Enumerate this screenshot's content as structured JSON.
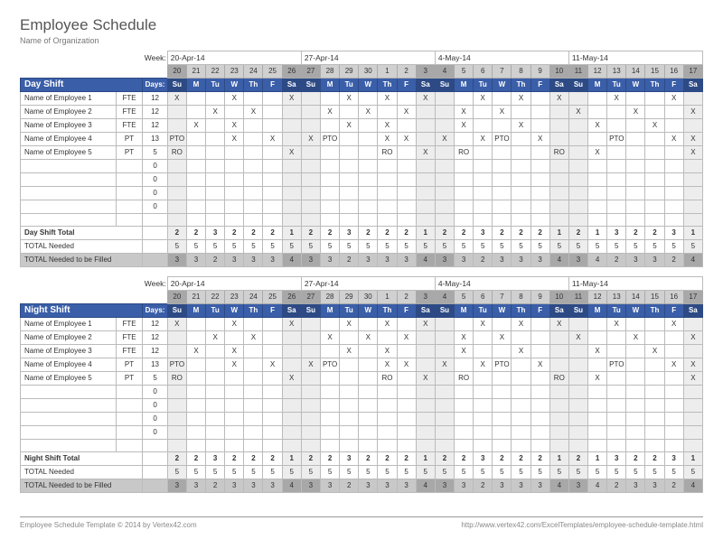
{
  "title": "Employee Schedule",
  "org": "Name of Organization",
  "week_label": "Week:",
  "weeks": [
    "20-Apr-14",
    "27-Apr-14",
    "4-May-14",
    "11-May-14"
  ],
  "day_nums": [
    20,
    21,
    22,
    23,
    24,
    25,
    26,
    27,
    28,
    29,
    30,
    1,
    2,
    3,
    4,
    5,
    6,
    7,
    8,
    9,
    10,
    11,
    12,
    13,
    14,
    15,
    16,
    17
  ],
  "day_abbr": [
    "Su",
    "M",
    "Tu",
    "W",
    "Th",
    "F",
    "Sa",
    "Su",
    "M",
    "Tu",
    "W",
    "Th",
    "F",
    "Sa",
    "Su",
    "M",
    "Tu",
    "W",
    "Th",
    "F",
    "Sa",
    "Su",
    "M",
    "Tu",
    "W",
    "Th",
    "F",
    "Sa"
  ],
  "weekend": [
    true,
    false,
    false,
    false,
    false,
    false,
    true,
    true,
    false,
    false,
    false,
    false,
    false,
    true,
    true,
    false,
    false,
    false,
    false,
    false,
    true,
    true,
    false,
    false,
    false,
    false,
    false,
    true
  ],
  "days_head": "Days:",
  "shifts": [
    {
      "name": "Day Shift",
      "employees": [
        {
          "name": "Name of Employee 1",
          "type": "FTE",
          "days": 12,
          "marks": [
            "X",
            "",
            "",
            "X",
            "",
            "",
            "X",
            "",
            "",
            "X",
            "",
            "X",
            "",
            "X",
            "",
            "",
            "X",
            "",
            "X",
            "",
            "X",
            "",
            "",
            "X",
            "",
            "",
            "X",
            ""
          ]
        },
        {
          "name": "Name of Employee 2",
          "type": "FTE",
          "days": 12,
          "marks": [
            "",
            "",
            "X",
            "",
            "X",
            "",
            "",
            "",
            "X",
            "",
            "X",
            "",
            "X",
            "",
            "",
            "X",
            "",
            "X",
            "",
            "",
            "",
            "X",
            "",
            "",
            "X",
            "",
            "",
            "X"
          ]
        },
        {
          "name": "Name of Employee 3",
          "type": "FTE",
          "days": 12,
          "marks": [
            "",
            "X",
            "",
            "X",
            "",
            "",
            "",
            "",
            "",
            "X",
            "",
            "X",
            "",
            "",
            "",
            "X",
            "",
            "",
            "X",
            "",
            "",
            "",
            "X",
            "",
            "",
            "X",
            "",
            ""
          ]
        },
        {
          "name": "Name of Employee 4",
          "type": "PT",
          "days": 13,
          "marks": [
            "PTO",
            "",
            "",
            "X",
            "",
            "X",
            "",
            "X",
            "PTO",
            "",
            "",
            "X",
            "X",
            "",
            "X",
            "",
            "X",
            "PTO",
            "",
            "X",
            "",
            "",
            "",
            "PTO",
            "",
            "",
            "X",
            "X"
          ]
        },
        {
          "name": "Name of Employee 5",
          "type": "PT",
          "days": 5,
          "marks": [
            "RO",
            "",
            "",
            "",
            "",
            "",
            "X",
            "",
            "",
            "",
            "",
            "RO",
            "",
            "X",
            "",
            "RO",
            "",
            "",
            "",
            "",
            "RO",
            "",
            "X",
            "",
            "",
            "",
            "",
            "X"
          ]
        }
      ],
      "blank_rows": 4,
      "totals": {
        "label": "Day Shift Total",
        "values": [
          2,
          2,
          3,
          2,
          2,
          2,
          1,
          2,
          2,
          3,
          2,
          2,
          2,
          1,
          2,
          2,
          3,
          2,
          2,
          2,
          1,
          2,
          1,
          3,
          2,
          2,
          3,
          1
        ]
      },
      "needed": {
        "label": "TOTAL Needed",
        "values": [
          5,
          5,
          5,
          5,
          5,
          5,
          5,
          5,
          5,
          5,
          5,
          5,
          5,
          5,
          5,
          5,
          5,
          5,
          5,
          5,
          5,
          5,
          5,
          5,
          5,
          5,
          5,
          5
        ]
      },
      "fill": {
        "label": "TOTAL Needed to be Filled",
        "values": [
          3,
          3,
          2,
          3,
          3,
          3,
          4,
          3,
          3,
          2,
          3,
          3,
          3,
          4,
          3,
          3,
          2,
          3,
          3,
          3,
          4,
          3,
          4,
          2,
          3,
          3,
          2,
          4
        ]
      }
    },
    {
      "name": "Night Shift",
      "employees": [
        {
          "name": "Name of Employee 1",
          "type": "FTE",
          "days": 12,
          "marks": [
            "X",
            "",
            "",
            "X",
            "",
            "",
            "X",
            "",
            "",
            "X",
            "",
            "X",
            "",
            "X",
            "",
            "",
            "X",
            "",
            "X",
            "",
            "X",
            "",
            "",
            "X",
            "",
            "",
            "X",
            ""
          ]
        },
        {
          "name": "Name of Employee 2",
          "type": "FTE",
          "days": 12,
          "marks": [
            "",
            "",
            "X",
            "",
            "X",
            "",
            "",
            "",
            "X",
            "",
            "X",
            "",
            "X",
            "",
            "",
            "X",
            "",
            "X",
            "",
            "",
            "",
            "X",
            "",
            "",
            "X",
            "",
            "",
            "X"
          ]
        },
        {
          "name": "Name of Employee 3",
          "type": "FTE",
          "days": 12,
          "marks": [
            "",
            "X",
            "",
            "X",
            "",
            "",
            "",
            "",
            "",
            "X",
            "",
            "X",
            "",
            "",
            "",
            "X",
            "",
            "",
            "X",
            "",
            "",
            "",
            "X",
            "",
            "",
            "X",
            "",
            ""
          ]
        },
        {
          "name": "Name of Employee 4",
          "type": "PT",
          "days": 13,
          "marks": [
            "PTO",
            "",
            "",
            "X",
            "",
            "X",
            "",
            "X",
            "PTO",
            "",
            "",
            "X",
            "X",
            "",
            "X",
            "",
            "X",
            "PTO",
            "",
            "X",
            "",
            "",
            "",
            "PTO",
            "",
            "",
            "X",
            "X"
          ]
        },
        {
          "name": "Name of Employee 5",
          "type": "PT",
          "days": 5,
          "marks": [
            "RO",
            "",
            "",
            "",
            "",
            "",
            "X",
            "",
            "",
            "",
            "",
            "RO",
            "",
            "X",
            "",
            "RO",
            "",
            "",
            "",
            "",
            "RO",
            "",
            "X",
            "",
            "",
            "",
            "",
            "X"
          ]
        }
      ],
      "blank_rows": 4,
      "totals": {
        "label": "Night Shift Total",
        "values": [
          2,
          2,
          3,
          2,
          2,
          2,
          1,
          2,
          2,
          3,
          2,
          2,
          2,
          1,
          2,
          2,
          3,
          2,
          2,
          2,
          1,
          2,
          1,
          3,
          2,
          2,
          3,
          1
        ]
      },
      "needed": {
        "label": "TOTAL Needed",
        "values": [
          5,
          5,
          5,
          5,
          5,
          5,
          5,
          5,
          5,
          5,
          5,
          5,
          5,
          5,
          5,
          5,
          5,
          5,
          5,
          5,
          5,
          5,
          5,
          5,
          5,
          5,
          5,
          5
        ]
      },
      "fill": {
        "label": "TOTAL Needed to be Filled",
        "values": [
          3,
          3,
          2,
          3,
          3,
          3,
          4,
          3,
          3,
          2,
          3,
          3,
          3,
          4,
          3,
          3,
          2,
          3,
          3,
          3,
          4,
          3,
          4,
          2,
          3,
          3,
          2,
          4
        ]
      }
    }
  ],
  "footer_left": "Employee Schedule Template © 2014 by Vertex42.com",
  "footer_right": "http://www.vertex42.com/ExcelTemplates/employee-schedule-template.html"
}
